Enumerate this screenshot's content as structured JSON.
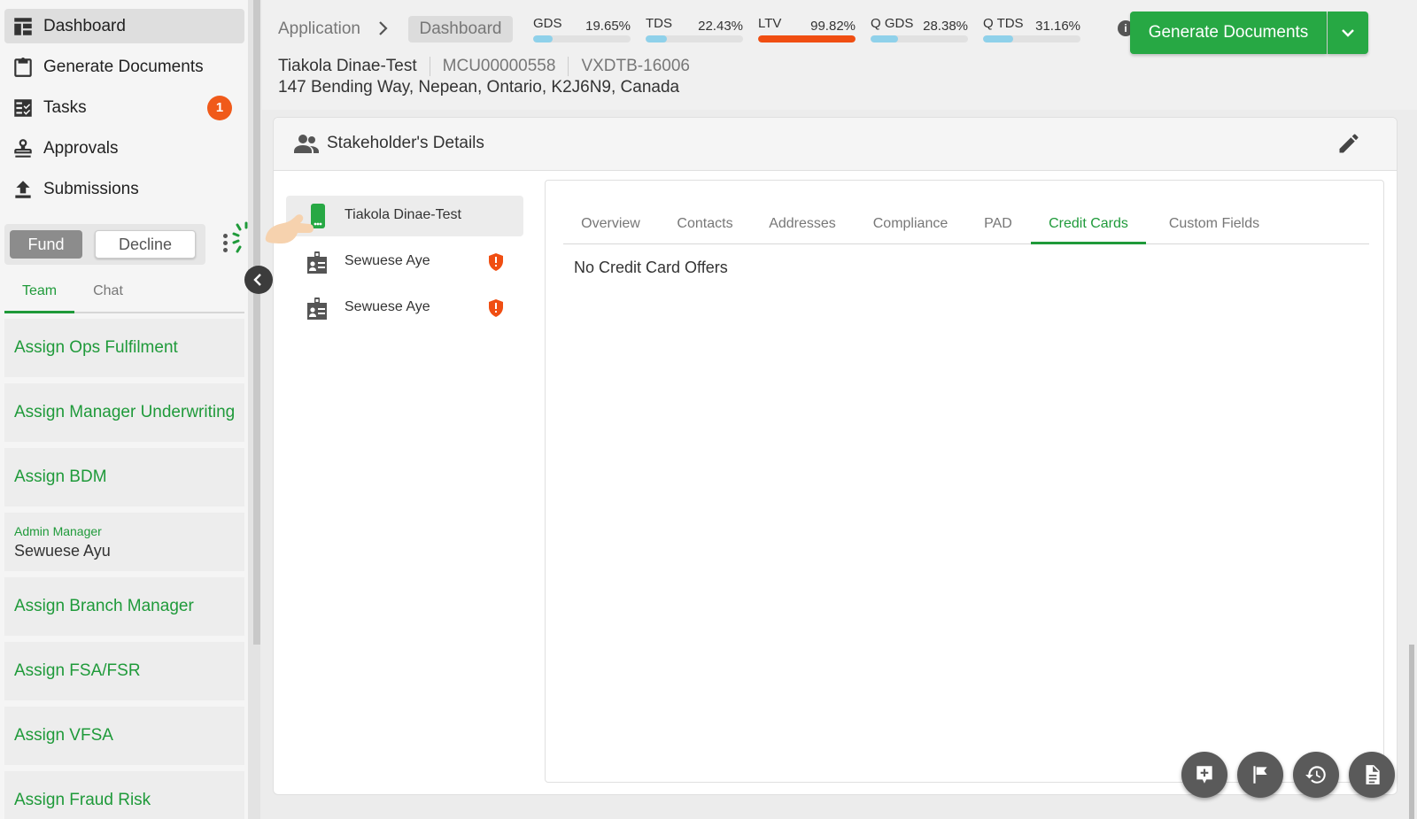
{
  "nav": [
    {
      "label": "Dashboard",
      "icon": "dashboard-icon",
      "active": true
    },
    {
      "label": "Generate Documents",
      "icon": "clipboard-icon"
    },
    {
      "label": "Tasks",
      "icon": "tasks-icon",
      "badge": "1"
    },
    {
      "label": "Approvals",
      "icon": "stamp-icon"
    },
    {
      "label": "Submissions",
      "icon": "upload-icon"
    }
  ],
  "actions": {
    "fund": "Fund",
    "decline": "Decline"
  },
  "side_tabs": [
    {
      "label": "Team",
      "active": true
    },
    {
      "label": "Chat"
    }
  ],
  "team": [
    {
      "label": "Assign Ops Fulfilment"
    },
    {
      "label": "Assign Manager Underwriting"
    },
    {
      "label": "Assign BDM"
    },
    {
      "role": "Admin Manager",
      "person": "Sewuese Ayu"
    },
    {
      "label": "Assign Branch Manager"
    },
    {
      "label": "Assign FSA/FSR"
    },
    {
      "label": "Assign VFSA"
    },
    {
      "label": "Assign Fraud Risk"
    }
  ],
  "breadcrumb": {
    "root": "Application",
    "current": "Dashboard"
  },
  "metrics": [
    {
      "label": "GDS",
      "value": "19.65%",
      "fill": 0.2
    },
    {
      "label": "TDS",
      "value": "22.43%",
      "fill": 0.22
    },
    {
      "label": "LTV",
      "value": "99.82%",
      "fill": 1.0,
      "warn": true
    },
    {
      "label": "Q GDS",
      "value": "28.38%",
      "fill": 0.28
    },
    {
      "label": "Q TDS",
      "value": "31.16%",
      "fill": 0.31
    }
  ],
  "generate_label": "Generate Documents",
  "client": {
    "name": "Tiakola Dinae-Test",
    "mcu": "MCU00000558",
    "ref": "VXDTB-16006",
    "address": "147 Bending Way, Nepean, Ontario, K2J6N9, Canada"
  },
  "panel_title": "Stakeholder's Details",
  "stakeholders": [
    {
      "name": "Tiakola Dinae-Test",
      "active": true
    },
    {
      "name": "Sewuese Aye",
      "flag": true
    },
    {
      "name": "Sewuese Aye",
      "flag": true
    }
  ],
  "detail_tabs": [
    {
      "label": "Overview"
    },
    {
      "label": "Contacts"
    },
    {
      "label": "Addresses"
    },
    {
      "label": "Compliance"
    },
    {
      "label": "PAD"
    },
    {
      "label": "Credit Cards",
      "active": true
    },
    {
      "label": "Custom Fields"
    }
  ],
  "empty_message": "No Credit Card Offers",
  "colors": {
    "accent": "#27a844",
    "warning": "#f04e12",
    "badge": "#f05a1a",
    "bar_fill": "#8fd1ea"
  }
}
